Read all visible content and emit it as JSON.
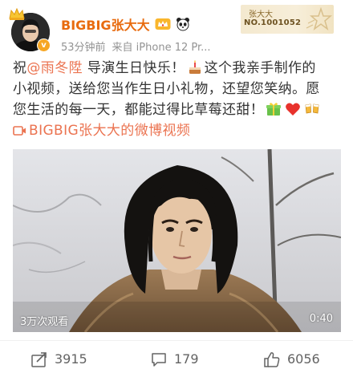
{
  "header": {
    "user_name": "BIGBIG张大大",
    "time": "53分钟前",
    "source": "来自 iPhone 12 Pr...",
    "verified_badge": "v",
    "fan_card": {
      "name": "张大大",
      "number": "NO.1001052"
    }
  },
  "post": {
    "line1_prefix": "祝",
    "mention": "@雨冬陞",
    "line1_suffix": " 导演生日快乐！",
    "line1_rest": "这个我亲手制作的",
    "line2": "小视频，送给您当作生日小礼物，还望您笑纳。愿",
    "line3": "您生活的每一天，都能过得比草莓还甜！",
    "video_link": "BIGBIG张大大的微博视频"
  },
  "video": {
    "views": "3万次观看",
    "duration": "0:40"
  },
  "actions": {
    "reposts": "3915",
    "comments": "179",
    "likes": "6056"
  },
  "colors": {
    "username": "#e86b0f",
    "link": "#eb7350",
    "text": "#333333",
    "meta": "#939393",
    "action": "#636363"
  },
  "icons": [
    "crown-icon",
    "verified-v-icon",
    "svip-crown-icon",
    "panda-icon",
    "fan-star-icon",
    "cake-emoji-icon",
    "gift-emoji-icon",
    "heart-emoji-icon",
    "cheers-emoji-icon",
    "video-link-icon",
    "repost-icon",
    "comment-icon",
    "like-icon"
  ]
}
